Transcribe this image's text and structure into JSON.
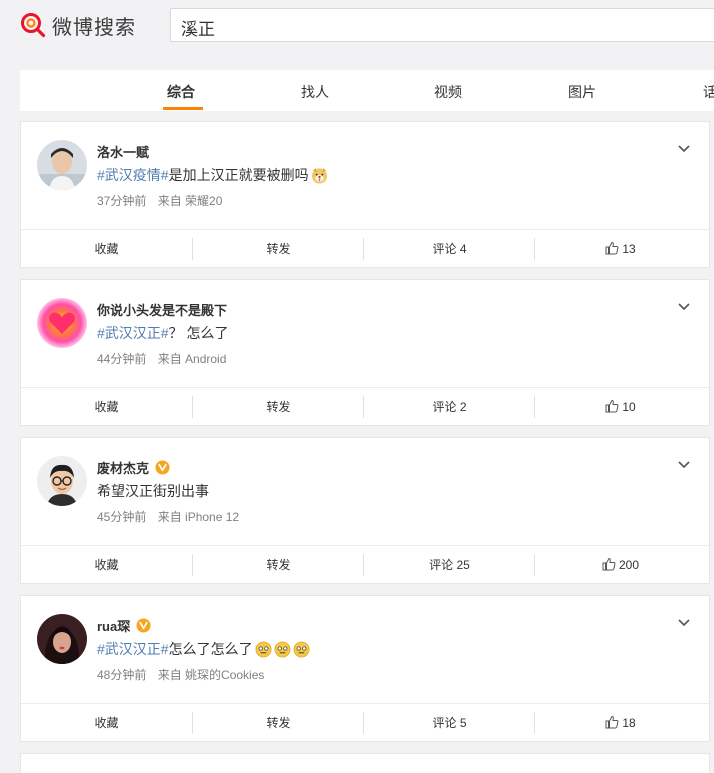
{
  "header": {
    "logo_text": "微博搜索",
    "search_query": "溪正"
  },
  "tabs": [
    {
      "label": "综合",
      "active": true
    },
    {
      "label": "找人",
      "active": false
    },
    {
      "label": "视频",
      "active": false
    },
    {
      "label": "图片",
      "active": false
    },
    {
      "label": "话",
      "active": false
    }
  ],
  "colors": {
    "accent": "#ff8200",
    "hashtag": "#507daf",
    "verified": "#f5a623"
  },
  "posts": [
    {
      "user": "洛水一赋",
      "verified": false,
      "hashtag": "#武汉疫情#",
      "text": "是加上汉正就要被删吗",
      "emojis": [
        "doge-emoji"
      ],
      "time": "37分钟前",
      "source": "来自 荣耀20",
      "actions": {
        "favorite": "收藏",
        "repost": "转发",
        "comment": "评论 4",
        "like": "13"
      }
    },
    {
      "user": "你说小头发是不是殿下",
      "verified": false,
      "hashtag": "#武汉汉正#",
      "text": "？ 怎么了",
      "emojis": [],
      "time": "44分钟前",
      "source": "来自 Android",
      "actions": {
        "favorite": "收藏",
        "repost": "转发",
        "comment": "评论 2",
        "like": "10"
      }
    },
    {
      "user": "废材杰克",
      "verified": true,
      "hashtag": "",
      "text": "希望汉正街别出事",
      "emojis": [],
      "time": "45分钟前",
      "source": "来自 iPhone 12",
      "actions": {
        "favorite": "收藏",
        "repost": "转发",
        "comment": "评论 25",
        "like": "200"
      }
    },
    {
      "user": "rua琛",
      "verified": true,
      "hashtag": "#武汉汉正#",
      "text": "怎么了怎么了",
      "emojis": [
        "awkward-emoji",
        "awkward-emoji",
        "awkward-emoji"
      ],
      "time": "48分钟前",
      "source": "来自 姚琛的Cookies",
      "actions": {
        "favorite": "收藏",
        "repost": "转发",
        "comment": "评论 5",
        "like": "18"
      }
    }
  ]
}
